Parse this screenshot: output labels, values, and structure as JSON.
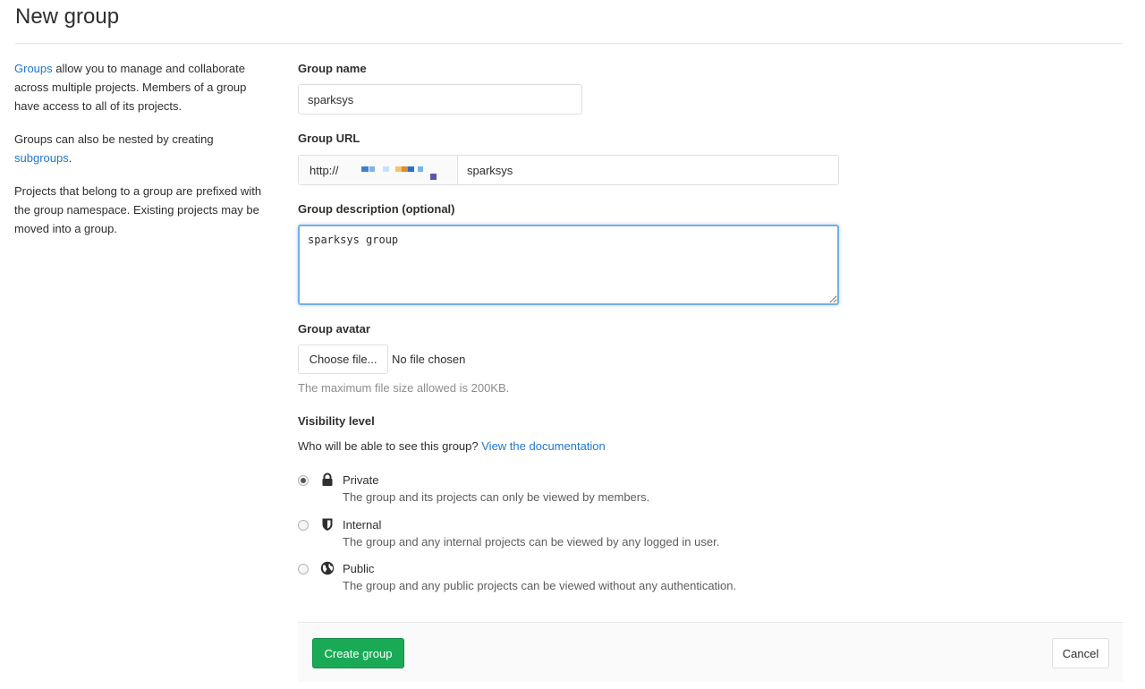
{
  "page": {
    "title": "New group"
  },
  "sidebar": {
    "p1_link": "Groups",
    "p1_text": " allow you to manage and collaborate across multiple projects. Members of a group have access to all of its projects.",
    "p2_text": "Groups can also be nested by creating ",
    "p2_link": "subgroups",
    "p2_end": ".",
    "p3_text": "Projects that belong to a group are prefixed with the group namespace. Existing projects may be moved into a group."
  },
  "form": {
    "group_name_label": "Group name",
    "group_name_value": "sparksys",
    "group_url_label": "Group URL",
    "group_url_prefix": "http://",
    "group_url_value": "sparksys",
    "description_label": "Group description (optional)",
    "description_value": "sparksys group",
    "avatar_label": "Group avatar",
    "choose_file_label": "Choose file...",
    "file_status": "No file chosen",
    "file_help": "The maximum file size allowed is 200KB.",
    "visibility_label": "Visibility level",
    "visibility_question": "Who will be able to see this group?",
    "visibility_doc_link": "View the documentation"
  },
  "visibility_options": [
    {
      "label": "Private",
      "help": "The group and its projects can only be viewed by members.",
      "icon": "lock-icon",
      "checked": true
    },
    {
      "label": "Internal",
      "help": "The group and any internal projects can be viewed by any logged in user.",
      "icon": "shield-icon",
      "checked": false
    },
    {
      "label": "Public",
      "help": "The group and any public projects can be viewed without any authentication.",
      "icon": "globe-icon",
      "checked": false
    }
  ],
  "footer": {
    "create_label": "Create group",
    "cancel_label": "Cancel"
  },
  "colors": {
    "link": "#1f78d1",
    "create_button": "#1aaa55",
    "focus_border": "#73afea"
  }
}
